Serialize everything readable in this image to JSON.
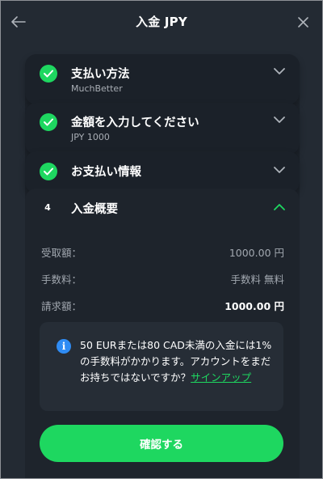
{
  "header": {
    "title": "入金 JPY"
  },
  "steps": [
    {
      "title": "支払い方法",
      "subtitle": "MuchBetter",
      "status": "complete"
    },
    {
      "title": "金額を入力してください",
      "subtitle": "JPY 1000",
      "status": "complete"
    },
    {
      "title": "お支払い情報",
      "status": "complete"
    },
    {
      "number": "4",
      "title": "入金概要",
      "status": "open"
    }
  ],
  "summary": {
    "rows": [
      {
        "label": "受取額：",
        "value": "1000.00 円"
      },
      {
        "label": "手数料：",
        "value": "手数料 無料"
      },
      {
        "label": "請求額：",
        "value": "1000.00 円"
      }
    ]
  },
  "notice": {
    "text": "50 EURまたは80 CAD未満の入金には1%の手数料がかかります。アカウントをまだお持ちではないですか？",
    "link_label": "サインアップ"
  },
  "confirm_label": "確認する",
  "colors": {
    "accent": "#1ed760",
    "info": "#2f8cf4",
    "background": "#232a33"
  }
}
